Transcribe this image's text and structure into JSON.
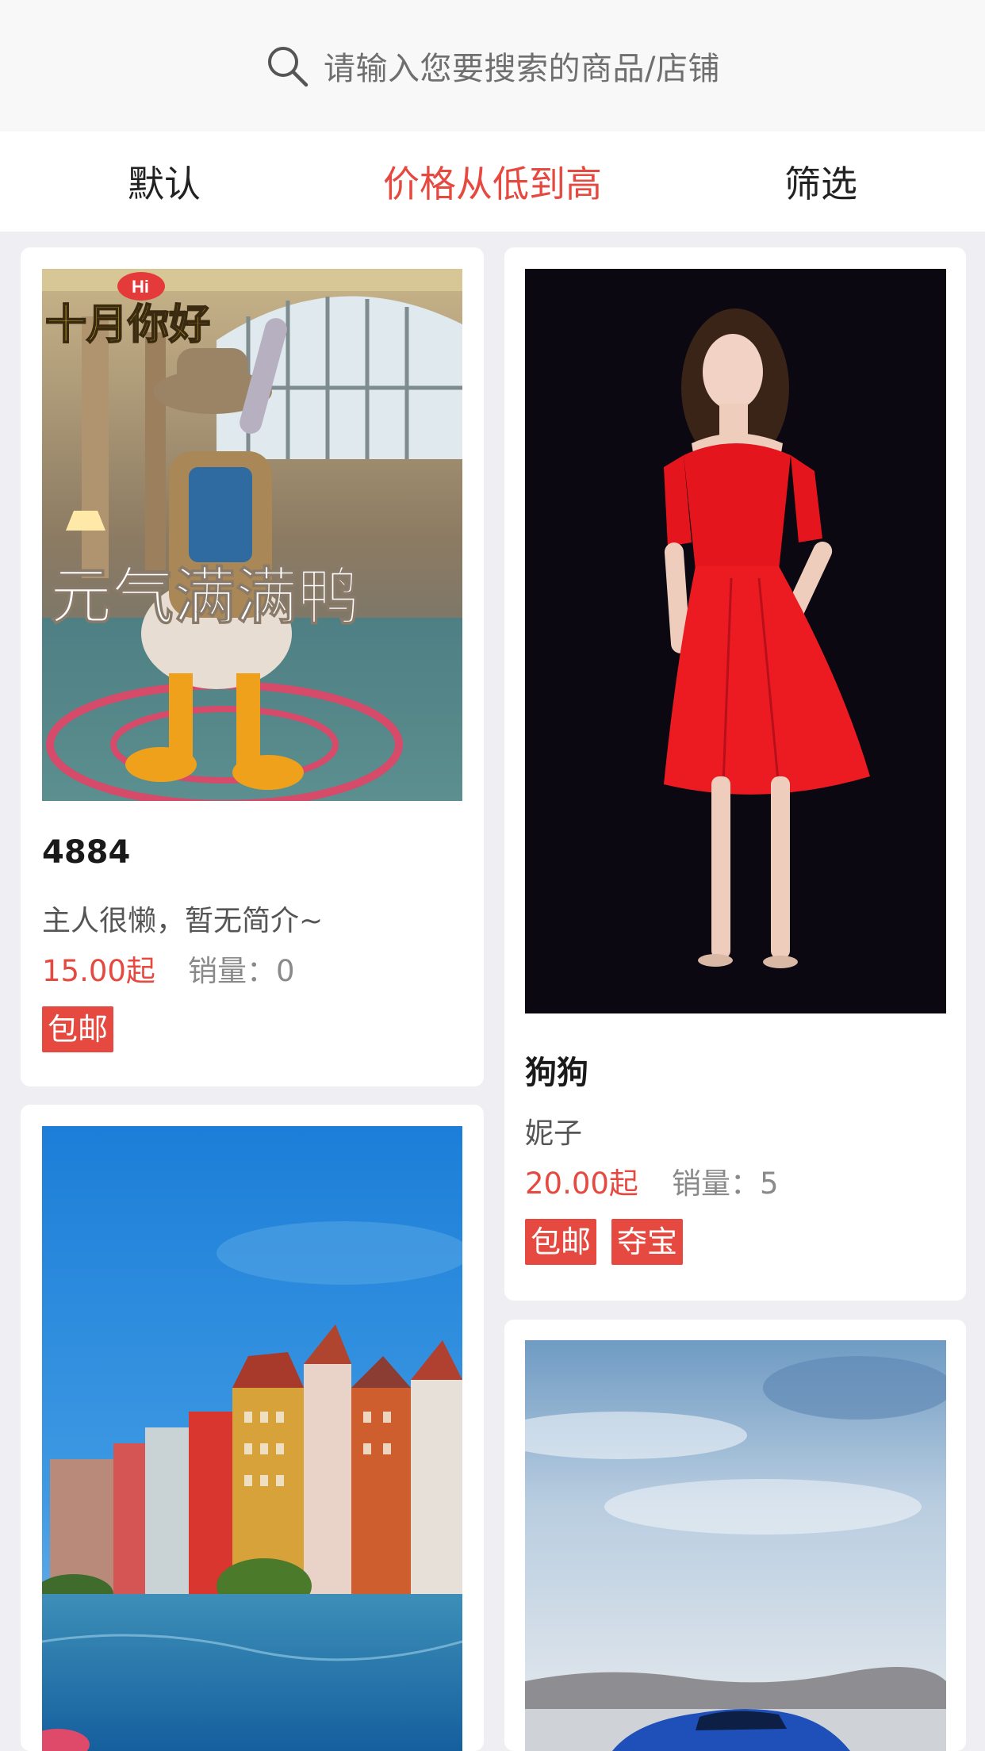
{
  "search": {
    "placeholder": "请输入您要搜索的商品/店铺"
  },
  "sort_bar": {
    "tabs": [
      {
        "label": "默认",
        "active": false
      },
      {
        "label": "价格从低到高",
        "active": true
      },
      {
        "label": "筛选",
        "active": false
      }
    ]
  },
  "products": [
    {
      "title": "4884",
      "desc": "主人很懒，暂无简介~",
      "price": "15.00起",
      "sales_label": "销量：",
      "sales": "0",
      "tags": [
        "包邮"
      ],
      "image_caption": "元气满满鸭",
      "image_badge": "十月你好"
    },
    {
      "title": "狗狗",
      "desc": "妮子",
      "price": "20.00起",
      "sales_label": "销量：",
      "sales": "5",
      "tags": [
        "包邮",
        "夺宝"
      ]
    }
  ],
  "colors": {
    "accent": "#e5493f",
    "page_bg": "#efeef3",
    "header_bg": "#f8f8f8"
  }
}
